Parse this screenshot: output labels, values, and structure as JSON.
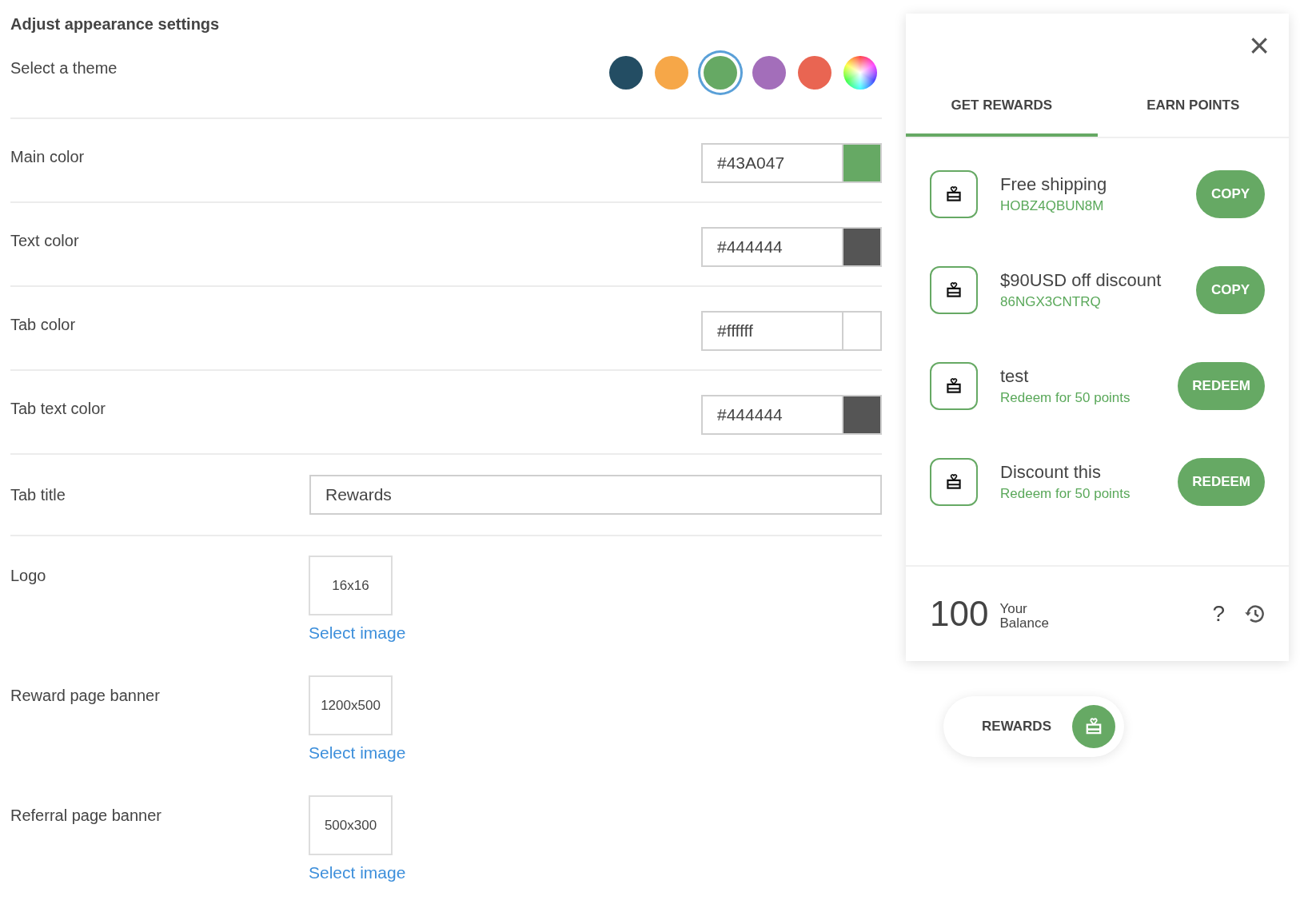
{
  "heading": "Adjust appearance settings",
  "theme": {
    "label": "Select a theme",
    "options": [
      {
        "kind": "solid",
        "color": "#234d63",
        "selected": false
      },
      {
        "kind": "solid",
        "color": "#f6a748",
        "selected": false
      },
      {
        "kind": "solid",
        "color": "#66a964",
        "selected": true
      },
      {
        "kind": "solid",
        "color": "#a36eba",
        "selected": false
      },
      {
        "kind": "solid",
        "color": "#e96552",
        "selected": false
      },
      {
        "kind": "custom",
        "selected": false
      }
    ]
  },
  "color_fields": [
    {
      "label": "Main color",
      "value": "#43A047",
      "color": "#66a964"
    },
    {
      "label": "Text color",
      "value": "#444444",
      "color": "#555555"
    },
    {
      "label": "Tab color",
      "value": "#ffffff",
      "color": "#ffffff"
    },
    {
      "label": "Tab text color",
      "value": "#444444",
      "color": "#555555"
    }
  ],
  "tab_title": {
    "label": "Tab title",
    "value": "Rewards"
  },
  "image_fields": [
    {
      "label": "Logo",
      "size": "16x16",
      "link": "Select image"
    },
    {
      "label": "Reward page banner",
      "size": "1200x500",
      "link": "Select image"
    },
    {
      "label": "Referral page banner",
      "size": "500x300",
      "link": "Select image"
    }
  ],
  "widget": {
    "close": "×",
    "tabs": [
      {
        "label": "GET REWARDS",
        "selected": true
      },
      {
        "label": "EARN POINTS",
        "selected": false
      }
    ],
    "rewards": [
      {
        "title": "Free shipping",
        "detail": "HOBZ4QBUN8M",
        "action": "COPY"
      },
      {
        "title": "$90USD off discount",
        "detail": "86NGX3CNTRQ",
        "action": "COPY"
      },
      {
        "title": "test",
        "detail": "Redeem for 50 points",
        "action": "REDEEM"
      },
      {
        "title": "Discount this",
        "detail": "Redeem for 50 points",
        "action": "REDEEM"
      }
    ],
    "balance": "100",
    "balance_label": "Your Balance",
    "help": "?"
  },
  "launcher": {
    "label": "REWARDS"
  }
}
